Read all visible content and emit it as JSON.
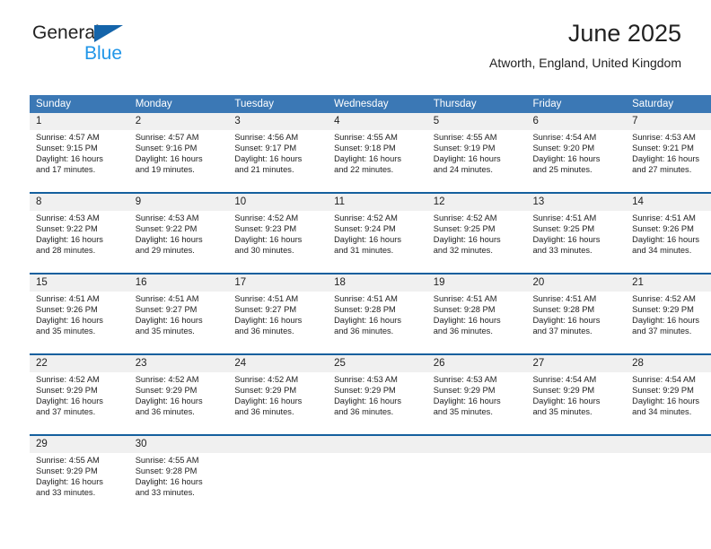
{
  "brand": {
    "line1": "General",
    "line2": "Blue",
    "triangle_color": "#1464aa",
    "line2_color": "#2196e8"
  },
  "header": {
    "title": "June 2025",
    "subtitle": "Atworth, England, United Kingdom"
  },
  "theme": {
    "header_bg": "#3b78b5",
    "header_text": "#ffffff",
    "daynum_bg": "#f0f0f0",
    "week_divider": "#15609e",
    "body_text": "#222222"
  },
  "calendar": {
    "weekday_headers": [
      "Sunday",
      "Monday",
      "Tuesday",
      "Wednesday",
      "Thursday",
      "Friday",
      "Saturday"
    ],
    "weeks": [
      [
        {
          "day": "1",
          "sunrise": "Sunrise: 4:57 AM",
          "sunset": "Sunset: 9:15 PM",
          "daylight1": "Daylight: 16 hours",
          "daylight2": "and 17 minutes."
        },
        {
          "day": "2",
          "sunrise": "Sunrise: 4:57 AM",
          "sunset": "Sunset: 9:16 PM",
          "daylight1": "Daylight: 16 hours",
          "daylight2": "and 19 minutes."
        },
        {
          "day": "3",
          "sunrise": "Sunrise: 4:56 AM",
          "sunset": "Sunset: 9:17 PM",
          "daylight1": "Daylight: 16 hours",
          "daylight2": "and 21 minutes."
        },
        {
          "day": "4",
          "sunrise": "Sunrise: 4:55 AM",
          "sunset": "Sunset: 9:18 PM",
          "daylight1": "Daylight: 16 hours",
          "daylight2": "and 22 minutes."
        },
        {
          "day": "5",
          "sunrise": "Sunrise: 4:55 AM",
          "sunset": "Sunset: 9:19 PM",
          "daylight1": "Daylight: 16 hours",
          "daylight2": "and 24 minutes."
        },
        {
          "day": "6",
          "sunrise": "Sunrise: 4:54 AM",
          "sunset": "Sunset: 9:20 PM",
          "daylight1": "Daylight: 16 hours",
          "daylight2": "and 25 minutes."
        },
        {
          "day": "7",
          "sunrise": "Sunrise: 4:53 AM",
          "sunset": "Sunset: 9:21 PM",
          "daylight1": "Daylight: 16 hours",
          "daylight2": "and 27 minutes."
        }
      ],
      [
        {
          "day": "8",
          "sunrise": "Sunrise: 4:53 AM",
          "sunset": "Sunset: 9:22 PM",
          "daylight1": "Daylight: 16 hours",
          "daylight2": "and 28 minutes."
        },
        {
          "day": "9",
          "sunrise": "Sunrise: 4:53 AM",
          "sunset": "Sunset: 9:22 PM",
          "daylight1": "Daylight: 16 hours",
          "daylight2": "and 29 minutes."
        },
        {
          "day": "10",
          "sunrise": "Sunrise: 4:52 AM",
          "sunset": "Sunset: 9:23 PM",
          "daylight1": "Daylight: 16 hours",
          "daylight2": "and 30 minutes."
        },
        {
          "day": "11",
          "sunrise": "Sunrise: 4:52 AM",
          "sunset": "Sunset: 9:24 PM",
          "daylight1": "Daylight: 16 hours",
          "daylight2": "and 31 minutes."
        },
        {
          "day": "12",
          "sunrise": "Sunrise: 4:52 AM",
          "sunset": "Sunset: 9:25 PM",
          "daylight1": "Daylight: 16 hours",
          "daylight2": "and 32 minutes."
        },
        {
          "day": "13",
          "sunrise": "Sunrise: 4:51 AM",
          "sunset": "Sunset: 9:25 PM",
          "daylight1": "Daylight: 16 hours",
          "daylight2": "and 33 minutes."
        },
        {
          "day": "14",
          "sunrise": "Sunrise: 4:51 AM",
          "sunset": "Sunset: 9:26 PM",
          "daylight1": "Daylight: 16 hours",
          "daylight2": "and 34 minutes."
        }
      ],
      [
        {
          "day": "15",
          "sunrise": "Sunrise: 4:51 AM",
          "sunset": "Sunset: 9:26 PM",
          "daylight1": "Daylight: 16 hours",
          "daylight2": "and 35 minutes."
        },
        {
          "day": "16",
          "sunrise": "Sunrise: 4:51 AM",
          "sunset": "Sunset: 9:27 PM",
          "daylight1": "Daylight: 16 hours",
          "daylight2": "and 35 minutes."
        },
        {
          "day": "17",
          "sunrise": "Sunrise: 4:51 AM",
          "sunset": "Sunset: 9:27 PM",
          "daylight1": "Daylight: 16 hours",
          "daylight2": "and 36 minutes."
        },
        {
          "day": "18",
          "sunrise": "Sunrise: 4:51 AM",
          "sunset": "Sunset: 9:28 PM",
          "daylight1": "Daylight: 16 hours",
          "daylight2": "and 36 minutes."
        },
        {
          "day": "19",
          "sunrise": "Sunrise: 4:51 AM",
          "sunset": "Sunset: 9:28 PM",
          "daylight1": "Daylight: 16 hours",
          "daylight2": "and 36 minutes."
        },
        {
          "day": "20",
          "sunrise": "Sunrise: 4:51 AM",
          "sunset": "Sunset: 9:28 PM",
          "daylight1": "Daylight: 16 hours",
          "daylight2": "and 37 minutes."
        },
        {
          "day": "21",
          "sunrise": "Sunrise: 4:52 AM",
          "sunset": "Sunset: 9:29 PM",
          "daylight1": "Daylight: 16 hours",
          "daylight2": "and 37 minutes."
        }
      ],
      [
        {
          "day": "22",
          "sunrise": "Sunrise: 4:52 AM",
          "sunset": "Sunset: 9:29 PM",
          "daylight1": "Daylight: 16 hours",
          "daylight2": "and 37 minutes."
        },
        {
          "day": "23",
          "sunrise": "Sunrise: 4:52 AM",
          "sunset": "Sunset: 9:29 PM",
          "daylight1": "Daylight: 16 hours",
          "daylight2": "and 36 minutes."
        },
        {
          "day": "24",
          "sunrise": "Sunrise: 4:52 AM",
          "sunset": "Sunset: 9:29 PM",
          "daylight1": "Daylight: 16 hours",
          "daylight2": "and 36 minutes."
        },
        {
          "day": "25",
          "sunrise": "Sunrise: 4:53 AM",
          "sunset": "Sunset: 9:29 PM",
          "daylight1": "Daylight: 16 hours",
          "daylight2": "and 36 minutes."
        },
        {
          "day": "26",
          "sunrise": "Sunrise: 4:53 AM",
          "sunset": "Sunset: 9:29 PM",
          "daylight1": "Daylight: 16 hours",
          "daylight2": "and 35 minutes."
        },
        {
          "day": "27",
          "sunrise": "Sunrise: 4:54 AM",
          "sunset": "Sunset: 9:29 PM",
          "daylight1": "Daylight: 16 hours",
          "daylight2": "and 35 minutes."
        },
        {
          "day": "28",
          "sunrise": "Sunrise: 4:54 AM",
          "sunset": "Sunset: 9:29 PM",
          "daylight1": "Daylight: 16 hours",
          "daylight2": "and 34 minutes."
        }
      ],
      [
        {
          "day": "29",
          "sunrise": "Sunrise: 4:55 AM",
          "sunset": "Sunset: 9:29 PM",
          "daylight1": "Daylight: 16 hours",
          "daylight2": "and 33 minutes."
        },
        {
          "day": "30",
          "sunrise": "Sunrise: 4:55 AM",
          "sunset": "Sunset: 9:28 PM",
          "daylight1": "Daylight: 16 hours",
          "daylight2": "and 33 minutes."
        },
        {
          "day": "",
          "sunrise": "",
          "sunset": "",
          "daylight1": "",
          "daylight2": ""
        },
        {
          "day": "",
          "sunrise": "",
          "sunset": "",
          "daylight1": "",
          "daylight2": ""
        },
        {
          "day": "",
          "sunrise": "",
          "sunset": "",
          "daylight1": "",
          "daylight2": ""
        },
        {
          "day": "",
          "sunrise": "",
          "sunset": "",
          "daylight1": "",
          "daylight2": ""
        },
        {
          "day": "",
          "sunrise": "",
          "sunset": "",
          "daylight1": "",
          "daylight2": ""
        }
      ]
    ]
  }
}
